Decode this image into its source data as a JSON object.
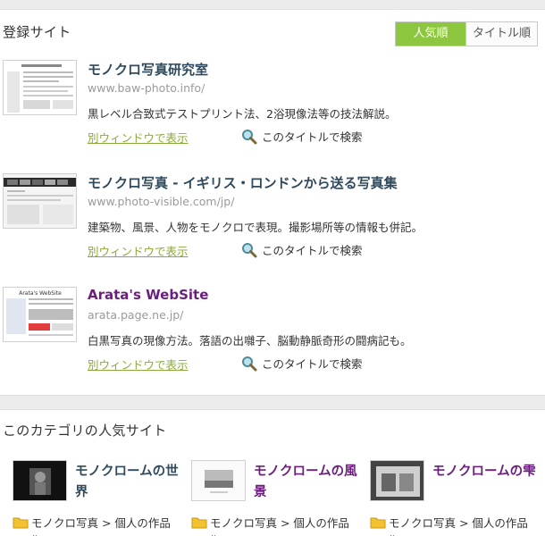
{
  "registered_sites": {
    "title": "登録サイト",
    "sort": {
      "popular_label": "人気順",
      "title_label": "タイトル順"
    },
    "entries": [
      {
        "title": "モノクロ写真研究室",
        "url": "www.baw-photo.info/",
        "description": "黒レベル合致式テストプリント法、2浴現像法等の技法解説。",
        "open_label": "別ウィンドウで表示",
        "search_label": "このタイトルで検索"
      },
      {
        "title": "モノクロ写真 - イギリス・ロンドンから送る写真集",
        "url": "www.photo-visible.com/jp/",
        "description": "建築物、風景、人物をモノクロで表現。撮影場所等の情報も併記。",
        "open_label": "別ウィンドウで表示",
        "search_label": "このタイトルで検索"
      },
      {
        "title": "Arata's WebSite",
        "url": "arata.page.ne.jp/",
        "description": "白黒写真の現像方法。落語の出囃子、脳動静脈奇形の闘病記も。",
        "open_label": "別ウィンドウで表示",
        "search_label": "このタイトルで検索",
        "thumb_text": "Arata's WebSite"
      }
    ]
  },
  "popular_sites": {
    "title": "このカテゴリの人気サイト",
    "items": [
      {
        "title": "モノクロームの世界",
        "category": "モノクロ写真 > 個人の作品",
        "category_cont": "集"
      },
      {
        "title": "モノクロームの風景",
        "category": "モノクロ写真 > 個人の作品",
        "category_cont": "集"
      },
      {
        "title": "モノクロームの雫",
        "category": "モノクロ写真 > 個人の作品",
        "category_cont": "集"
      }
    ]
  },
  "colors": {
    "accent_green": "#8dc63f",
    "link_green": "#8aab3a",
    "title_blue": "#2f4a5c",
    "visited_purple": "#6b1e7c"
  },
  "icons": {
    "search": "magnifier-icon",
    "category": "folder-icon"
  }
}
